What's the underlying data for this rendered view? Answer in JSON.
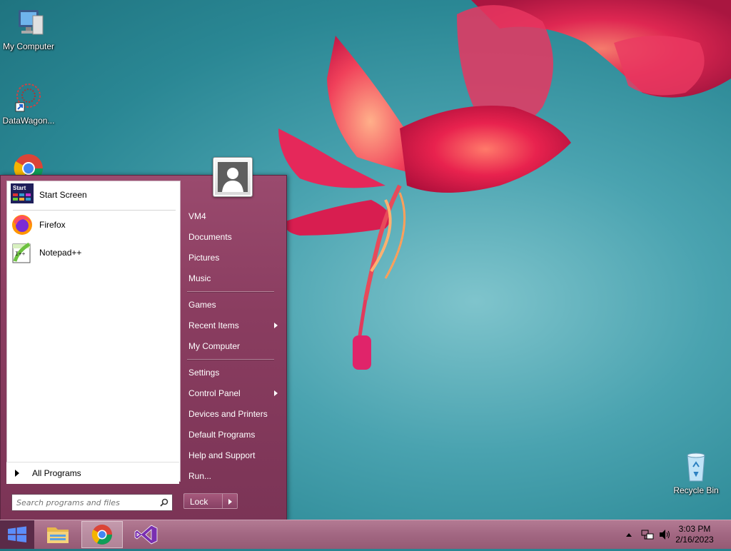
{
  "desktop": {
    "icons": [
      {
        "label": "My Computer"
      },
      {
        "label": "DataWagon..."
      },
      {
        "label": "Recycle Bin"
      }
    ]
  },
  "start_menu": {
    "pinned": [
      {
        "label": "Start Screen",
        "icon": "start-screen-icon"
      },
      {
        "label": "Firefox",
        "icon": "firefox-icon"
      },
      {
        "label": "Notepad++",
        "icon": "notepad-plus-plus-icon"
      }
    ],
    "all_programs": "All Programs",
    "search_placeholder": "Search programs and files",
    "right_items": [
      {
        "label": "VM4"
      },
      {
        "label": "Documents"
      },
      {
        "label": "Pictures"
      },
      {
        "label": "Music"
      },
      {
        "label": "Games"
      },
      {
        "label": "Recent Items"
      },
      {
        "label": "My Computer"
      },
      {
        "label": "Settings"
      },
      {
        "label": "Control Panel"
      },
      {
        "label": "Devices and Printers"
      },
      {
        "label": "Default Programs"
      },
      {
        "label": "Help and Support"
      },
      {
        "label": "Run..."
      }
    ],
    "lock_label": "Lock"
  },
  "taskbar": {
    "apps": [
      "file-explorer-icon",
      "chrome-icon",
      "visual-studio-icon"
    ],
    "active_app": "chrome-icon",
    "time": "3:03 PM",
    "date": "2/16/2023"
  },
  "colors": {
    "menu_bg": "#8a3d60",
    "taskbar_bg": "#a26782",
    "desktop_bg": "#2a8794"
  }
}
